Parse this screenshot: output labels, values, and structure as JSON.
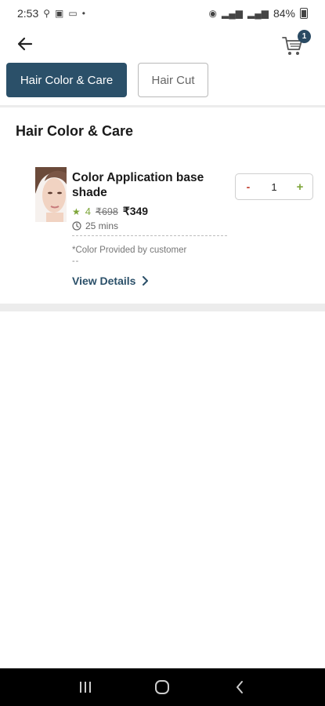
{
  "status_bar": {
    "time": "2:53",
    "battery": "84%"
  },
  "header": {
    "cart_count": "1"
  },
  "tabs": [
    {
      "label": "Hair Color & Care",
      "active": true
    },
    {
      "label": "Hair Cut",
      "active": false
    }
  ],
  "section": {
    "title": "Hair Color & Care"
  },
  "service": {
    "name": "Color Application base shade",
    "rating": "4",
    "old_price": "₹698",
    "new_price": "₹349",
    "duration": "25 mins",
    "note": "*Color Provided by customer",
    "note_more": "--",
    "view_details": "View Details",
    "quantity": "1",
    "minus_label": "-",
    "plus_label": "+"
  },
  "colors": {
    "primary": "#2b5069",
    "accent_green": "#7ea63a",
    "minus_red": "#c0392b"
  },
  "icons": {
    "back": "arrow-left-icon",
    "cart": "cart-icon",
    "star": "star-icon",
    "clock": "clock-icon",
    "chevron": "chevron-right-icon"
  }
}
